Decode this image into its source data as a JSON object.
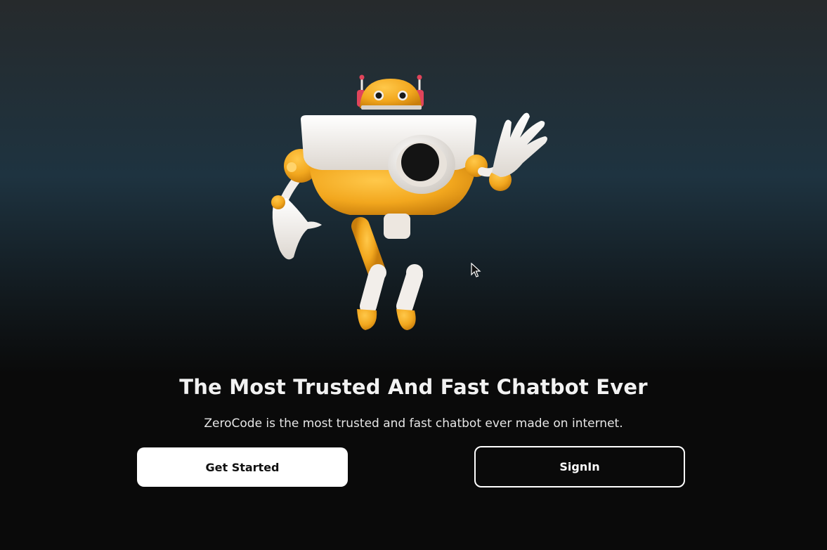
{
  "hero": {
    "title": "The Most Trusted And Fast Chatbot Ever",
    "subtitle": "ZeroCode is the most trusted and fast chatbot ever made on internet.",
    "illustration_icon": "robot-mascot-icon"
  },
  "actions": {
    "primary_label": "Get Started",
    "secondary_label": "SignIn"
  },
  "colors": {
    "robot_yellow": "#F2A71E",
    "robot_white": "#F2EEEA",
    "antenna_red": "#E0445A",
    "button_bg": "#FFFFFF",
    "button_text": "#111111"
  }
}
